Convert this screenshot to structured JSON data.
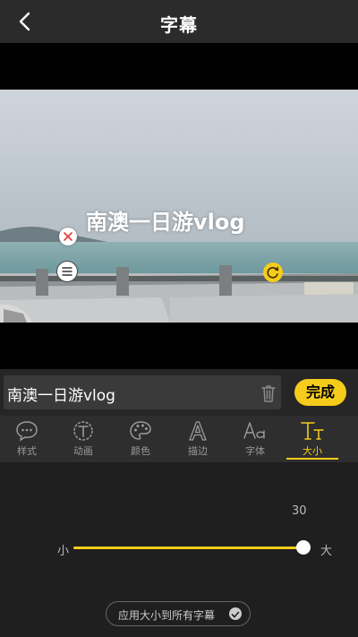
{
  "header": {
    "title": "字幕",
    "back_icon": "chevron-left-icon"
  },
  "preview": {
    "caption_text": "南澳一日游vlog"
  },
  "editor": {
    "input_value": "南澳一日游vlog",
    "done_label": "完成"
  },
  "tabs": [
    {
      "label": "样式",
      "icon": "speech-bubble-icon"
    },
    {
      "label": "动画",
      "icon": "circle-t-icon"
    },
    {
      "label": "颜色",
      "icon": "palette-icon"
    },
    {
      "label": "描边",
      "icon": "outline-a-icon"
    },
    {
      "label": "字体",
      "icon": "font-aa-icon"
    },
    {
      "label": "大小",
      "icon": "font-size-icon",
      "active": true
    }
  ],
  "size_panel": {
    "value": "30",
    "min_label": "小",
    "max_label": "大",
    "slider_fraction": 1.0,
    "apply_all_label": "应用大小到所有字幕"
  },
  "colors": {
    "accent": "#f5cc1b",
    "background": "#1f1f1f",
    "bar": "#2b2b2b"
  }
}
